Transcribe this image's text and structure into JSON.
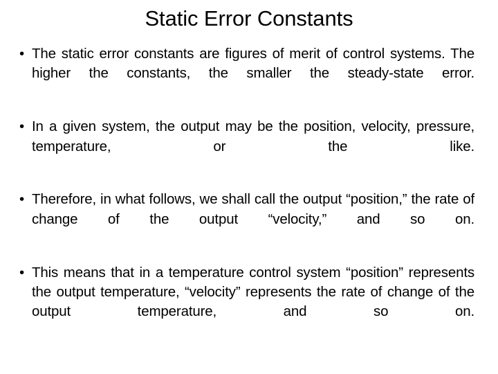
{
  "slide": {
    "title": "Static Error Constants",
    "background_color": "#ffffff",
    "text_color": "#000000",
    "bullet_marker": "•",
    "bullets": [
      {
        "text": "The static error constants are figures of merit of control systems. The higher the constants, the smaller the steady-state error."
      },
      {
        "text": "In a given system, the output may be the position, velocity, pressure, temperature, or the like."
      },
      {
        "text": "Therefore, in what follows, we shall call the output “position,” the rate of change of the output “velocity,” and so on."
      },
      {
        "text": "This means that in a temperature control system “position” represents the output temperature, “velocity” represents the rate of change of the output temperature, and so on."
      }
    ]
  }
}
